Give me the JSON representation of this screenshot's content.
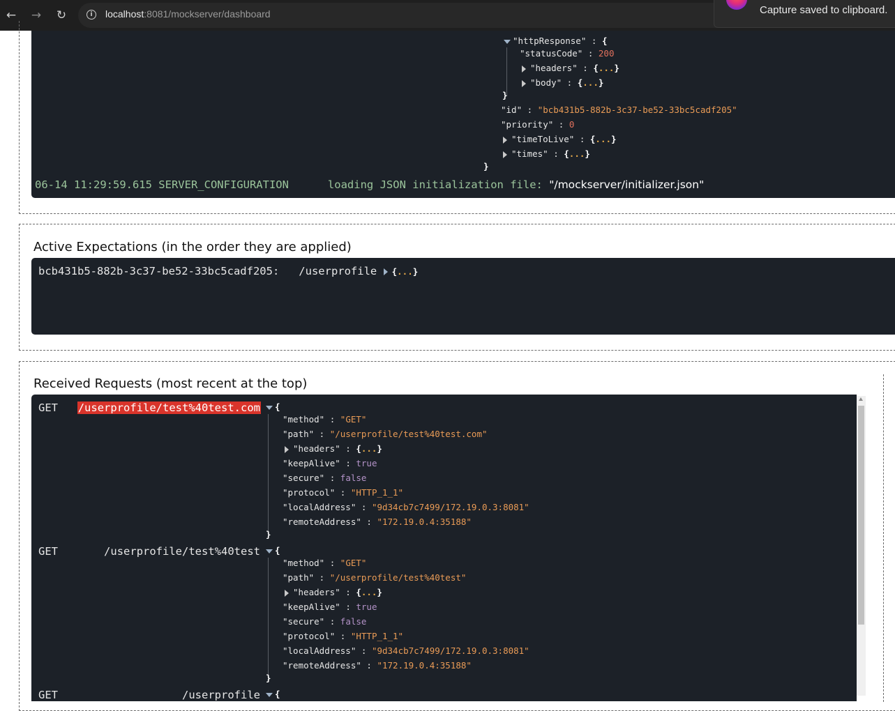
{
  "browser": {
    "url_host": "localhost",
    "url_rest": ":8081/mockserver/dashboard",
    "back_glyph": "←",
    "forward_glyph": "→",
    "reload_glyph": "↻",
    "toast_text": "Capture saved to clipboard."
  },
  "top_json": {
    "httpResponse_key": "\"httpResponse\"",
    "statusCode_key": "\"statusCode\"",
    "statusCode_value": "200",
    "headers_key": "\"headers\"",
    "body_key": "\"body\"",
    "id_key": "\"id\"",
    "id_value": "\"bcb431b5-882b-3c37-be52-33bc5cadf205\"",
    "priority_key": "\"priority\"",
    "priority_value": "0",
    "timeToLive_key": "\"timeToLive\"",
    "times_key": "\"times\""
  },
  "log_line": {
    "prefix": "06-14 11:29:59.615 SERVER_CONFIGURATION      loading JSON initialization file: ",
    "file": "\"/mockserver/initializer.json\""
  },
  "active_expectations": {
    "title": "Active Expectations (in the order they are applied)",
    "items": [
      {
        "id": "bcb431b5-882b-3c37-be52-33bc5cadf205:",
        "path": "/userprofile"
      }
    ]
  },
  "received_requests": {
    "title": "Received Requests (most recent at the top)",
    "items": [
      {
        "method_label": "GET",
        "path_label": "/userprofile/test%40test.com",
        "fields": {
          "method_key": "\"method\"",
          "method": "\"GET\"",
          "path_key": "\"path\"",
          "path": "\"/userprofile/test%40test.com\"",
          "headers_key": "\"headers\"",
          "keepAlive_key": "\"keepAlive\"",
          "keepAlive": "true",
          "secure_key": "\"secure\"",
          "secure": "false",
          "protocol_key": "\"protocol\"",
          "protocol": "\"HTTP_1_1\"",
          "localAddress_key": "\"localAddress\"",
          "localAddress": "\"9d34cb7c7499/172.19.0.3:8081\"",
          "remoteAddress_key": "\"remoteAddress\"",
          "remoteAddress": "\"172.19.0.4:35188\""
        }
      },
      {
        "method_label": "GET",
        "path_label": "/userprofile/test%40test",
        "fields": {
          "method_key": "\"method\"",
          "method": "\"GET\"",
          "path_key": "\"path\"",
          "path": "\"/userprofile/test%40test\"",
          "headers_key": "\"headers\"",
          "keepAlive_key": "\"keepAlive\"",
          "keepAlive": "true",
          "secure_key": "\"secure\"",
          "secure": "false",
          "protocol_key": "\"protocol\"",
          "protocol": "\"HTTP_1_1\"",
          "localAddress_key": "\"localAddress\"",
          "localAddress": "\"9d34cb7c7499/172.19.0.3:8081\"",
          "remoteAddress_key": "\"remoteAddress\"",
          "remoteAddress": "\"172.19.0.4:35188\""
        }
      },
      {
        "method_label": "GET",
        "path_label": "/userprofile"
      }
    ]
  },
  "punct": {
    "open_brace": "{",
    "close_brace": "}",
    "collapsed": "...",
    "colon": " : "
  },
  "colors": {
    "topbar": "#1f1f1f",
    "dark_panel": "#1c2128",
    "string": "#e99b56",
    "number": "#e2715d",
    "boolean": "#b493c8",
    "highlight": "#d9342b",
    "log_text": "#9bc49b"
  }
}
